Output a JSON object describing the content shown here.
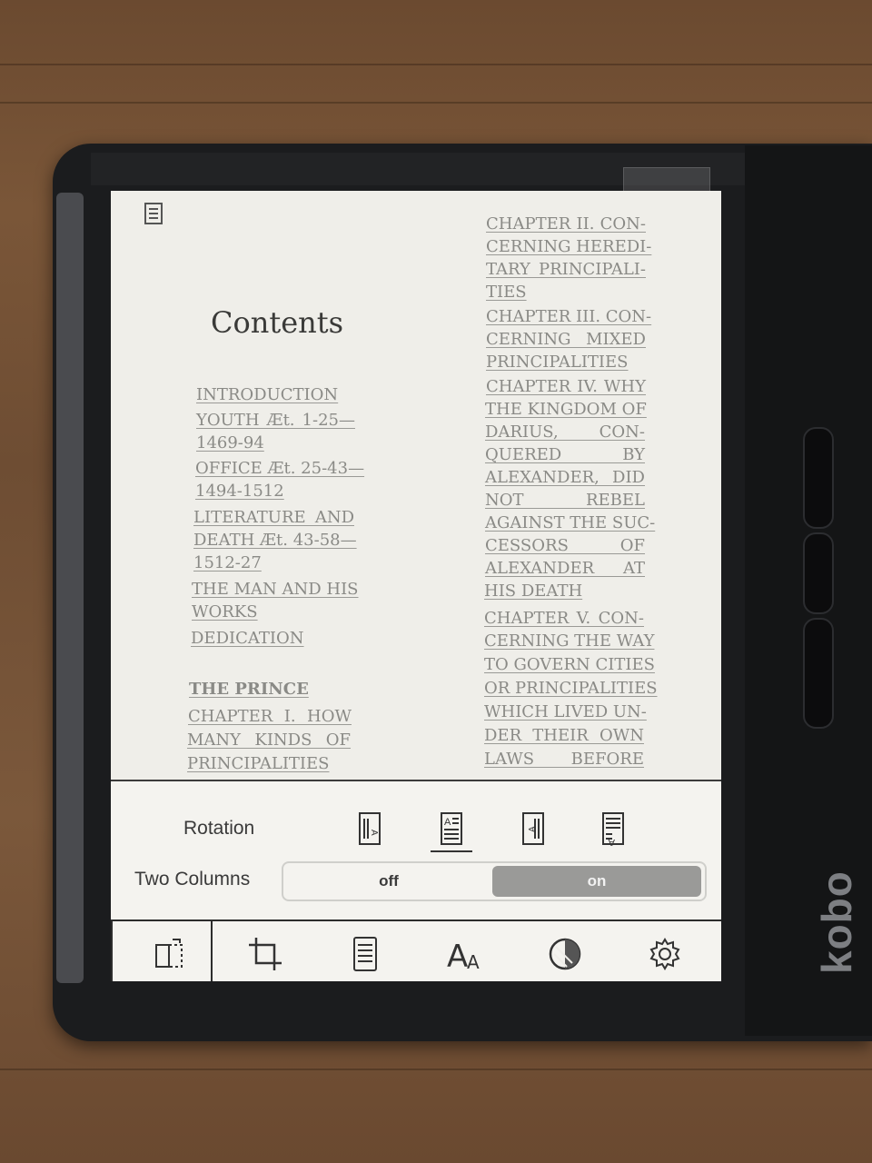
{
  "device": {
    "brand": "kobo"
  },
  "page": {
    "title": "Contents",
    "left_column": [
      {
        "text": "INTRODUCTION",
        "bold": false
      },
      {
        "text": "YOUTH Æt. 1-25—",
        "bold": false
      },
      {
        "text": "1469-94",
        "bold": false
      },
      {
        "text": "OFFICE Æt. 25-43—",
        "bold": false
      },
      {
        "text": "1494-1512",
        "bold": false
      },
      {
        "text": "LITERATURE AND",
        "bold": false
      },
      {
        "text": "DEATH Æt. 43-58—",
        "bold": false
      },
      {
        "text": "1512-27",
        "bold": false
      },
      {
        "text": "THE MAN AND HIS",
        "bold": false
      },
      {
        "text": "WORKS",
        "bold": false
      },
      {
        "text": "DEDICATION",
        "bold": false
      },
      {
        "text": "THE PRINCE",
        "bold": true
      },
      {
        "text": "CHAPTER I. HOW",
        "bold": false
      },
      {
        "text": "MANY KINDS OF",
        "bold": false
      },
      {
        "text": "PRINCIPALITIES",
        "bold": false
      }
    ],
    "right_column": [
      "CHAPTER II. CON-",
      "CERNING HEREDI-",
      "TARY PRINCIPALI-",
      "TIES",
      "CHAPTER III. CON-",
      "CERNING MIXED",
      "PRINCIPALITIES",
      "CHAPTER IV. WHY",
      "THE KINGDOM OF",
      "DARIUS, CON-",
      "QUERED BY",
      "ALEXANDER, DID",
      "NOT REBEL",
      "AGAINST THE SUC-",
      "CESSORS OF",
      "ALEXANDER AT",
      "HIS DEATH",
      "CHAPTER V. CON-",
      "CERNING THE WAY",
      "TO GOVERN CITIES",
      "OR PRINCIPALITIES",
      "WHICH LIVED UN-",
      "DER THEIR OWN",
      "LAWS BEFORE"
    ]
  },
  "settings": {
    "rotation_label": "Rotation",
    "rotation_options": [
      "portrait-left-icon",
      "portrait-icon",
      "portrait-right-icon",
      "portrait-flipped-icon"
    ],
    "rotation_selected": 1,
    "two_columns_label": "Two Columns",
    "toggle_off": "off",
    "toggle_on": "on",
    "toggle_value": "on"
  },
  "tabs": [
    "orientation-icon",
    "crop-icon",
    "page-layout-icon",
    "font-size-icon",
    "contrast-icon",
    "settings-gear-icon"
  ]
}
